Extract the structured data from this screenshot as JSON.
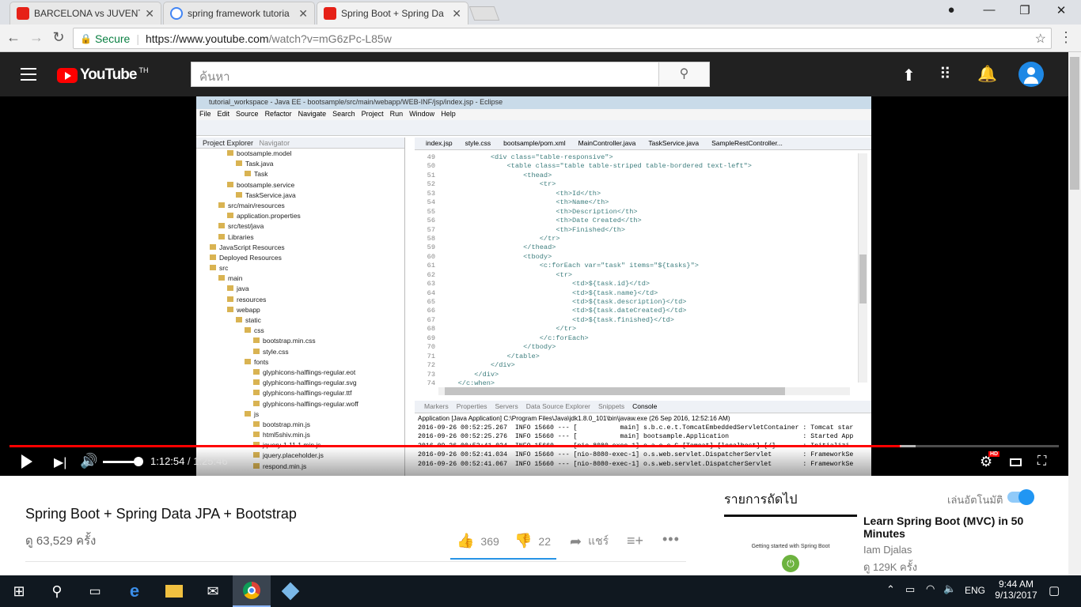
{
  "browser": {
    "tabs": [
      {
        "title": "BARCELONA vs JUVENTUS",
        "favicon": "youtube-icon"
      },
      {
        "title": "spring framework tutoria",
        "favicon": "google-icon"
      },
      {
        "title": "Spring Boot + Spring Da",
        "favicon": "youtube-icon",
        "active": true
      }
    ],
    "secure_label": "Secure",
    "url_prefix": "https://www.youtube.com",
    "url_path": "/watch?v=mG6zPc-L85w"
  },
  "youtube": {
    "logo_text": "YouTube",
    "region": "TH",
    "search_placeholder": "ค้นหา"
  },
  "eclipse": {
    "title": "tutorial_workspace - Java EE - bootsample/src/main/webapp/WEB-INF/jsp/index.jsp - Eclipse",
    "menu": [
      "File",
      "Edit",
      "Source",
      "Refactor",
      "Navigate",
      "Search",
      "Project",
      "Run",
      "Window",
      "Help"
    ],
    "project_tabs": [
      "Project Explorer",
      "Navigator"
    ],
    "tree": [
      {
        "indent": 3,
        "text": "bootsample.model"
      },
      {
        "indent": 4,
        "text": "Task.java"
      },
      {
        "indent": 5,
        "text": "Task"
      },
      {
        "indent": 3,
        "text": "bootsample.service"
      },
      {
        "indent": 4,
        "text": "TaskService.java"
      },
      {
        "indent": 2,
        "text": "src/main/resources"
      },
      {
        "indent": 3,
        "text": "application.properties"
      },
      {
        "indent": 2,
        "text": "src/test/java"
      },
      {
        "indent": 2,
        "text": "Libraries"
      },
      {
        "indent": 1,
        "text": "JavaScript Resources"
      },
      {
        "indent": 1,
        "text": "Deployed Resources"
      },
      {
        "indent": 1,
        "text": "src"
      },
      {
        "indent": 2,
        "text": "main"
      },
      {
        "indent": 3,
        "text": "java"
      },
      {
        "indent": 3,
        "text": "resources"
      },
      {
        "indent": 3,
        "text": "webapp"
      },
      {
        "indent": 4,
        "text": "static"
      },
      {
        "indent": 5,
        "text": "css"
      },
      {
        "indent": 6,
        "text": "bootstrap.min.css"
      },
      {
        "indent": 6,
        "text": "style.css"
      },
      {
        "indent": 5,
        "text": "fonts"
      },
      {
        "indent": 6,
        "text": "glyphicons-halflings-regular.eot"
      },
      {
        "indent": 6,
        "text": "glyphicons-halflings-regular.svg"
      },
      {
        "indent": 6,
        "text": "glyphicons-halflings-regular.ttf"
      },
      {
        "indent": 6,
        "text": "glyphicons-halflings-regular.woff"
      },
      {
        "indent": 5,
        "text": "js"
      },
      {
        "indent": 6,
        "text": "bootstrap.min.js"
      },
      {
        "indent": 6,
        "text": "html5shiv.min.js"
      },
      {
        "indent": 6,
        "text": "jquery-1.11.1.min.js"
      },
      {
        "indent": 6,
        "text": "jquery.placeholder.js"
      },
      {
        "indent": 6,
        "text": "respond.min.js"
      }
    ],
    "editor_tabs": [
      "index.jsp",
      "style.css",
      "bootsample/pom.xml",
      "MainController.java",
      "TaskService.java",
      "SampleRestController..."
    ],
    "code": [
      {
        "n": "49",
        "t": "            <div class=\"table-responsive\">"
      },
      {
        "n": "50",
        "t": "                <table class=\"table table-striped table-bordered text-left\">"
      },
      {
        "n": "51",
        "t": "                    <thead>"
      },
      {
        "n": "52",
        "t": "                        <tr>"
      },
      {
        "n": "53",
        "t": "                            <th>Id</th>"
      },
      {
        "n": "54",
        "t": "                            <th>Name</th>"
      },
      {
        "n": "55",
        "t": "                            <th>Description</th>"
      },
      {
        "n": "56",
        "t": "                            <th>Date Created</th>"
      },
      {
        "n": "57",
        "t": "                            <th>Finished</th>"
      },
      {
        "n": "58",
        "t": "                        </tr>"
      },
      {
        "n": "59",
        "t": "                    </thead>"
      },
      {
        "n": "60",
        "t": "                    <tbody>"
      },
      {
        "n": "61",
        "t": "                        <c:forEach var=\"task\" items=\"${tasks}\">"
      },
      {
        "n": "62",
        "t": "                            <tr>"
      },
      {
        "n": "63",
        "t": "                                <td>${task.id}</td>"
      },
      {
        "n": "64",
        "t": "                                <td>${task.name}</td>"
      },
      {
        "n": "65",
        "t": "                                <td>${task.description}</td>"
      },
      {
        "n": "66",
        "t": "                                <td>${task.dateCreated}</td>"
      },
      {
        "n": "67",
        "t": "                                <td>${task.finished}</td>"
      },
      {
        "n": "68",
        "t": "                            </tr>"
      },
      {
        "n": "69",
        "t": "                        </c:forEach>"
      },
      {
        "n": "70",
        "t": "                    </tbody>"
      },
      {
        "n": "71",
        "t": "                </table>"
      },
      {
        "n": "72",
        "t": "            </div>"
      },
      {
        "n": "73",
        "t": "        </div>"
      },
      {
        "n": "74",
        "t": "    </c:when>"
      }
    ],
    "console_tabs": [
      "Markers",
      "Properties",
      "Servers",
      "Data Source Explorer",
      "Snippets",
      "Console"
    ],
    "console_header": "Application [Java Application] C:\\Program Files\\Java\\jdk1.8.0_101\\bin\\javaw.exe (26 Sep 2016, 12:52:16 AM)",
    "console_lines": [
      "2016-09-26 00:52:25.267  INFO 15660 --- [           main] s.b.c.e.t.TomcatEmbeddedServletContainer : Tomcat star",
      "2016-09-26 00:52:25.276  INFO 15660 --- [           main] bootsample.Application                   : Started App",
      "2016-09-26 00:52:41.034  INFO 15660 --- [nio-8080-exec-1] o.a.c.c.C.[Tomcat].[localhost].[/]       : Initializi",
      "2016-09-26 00:52:41.034  INFO 15660 --- [nio-8080-exec-1] o.s.web.servlet.DispatcherServlet        : FrameworkSe",
      "2016-09-26 00:52:41.067  INFO 15660 --- [nio-8080-exec-1] o.s.web.servlet.DispatcherServlet        : FrameworkSe"
    ]
  },
  "player": {
    "current_time": "1:12:54",
    "separator": " / ",
    "duration": "1:25:46",
    "progress_fraction": 0.85,
    "hd_badge": "HD"
  },
  "video": {
    "title": "Spring Boot + Spring Data JPA + Bootstrap",
    "views": "ดู 63,529 ครั้ง",
    "likes": "369",
    "dislikes": "22",
    "share_label": "แชร์"
  },
  "upnext": {
    "heading": "รายการถัดไป",
    "autoplay_label": "เล่นอัตโนมัติ",
    "title": "Learn Spring Boot (MVC) in 50 Minutes",
    "channel": "Iam Djalas",
    "views": "ดู 129K ครั้ง",
    "thumb_text": "Getting started with Spring Boot"
  },
  "taskbar": {
    "lang": "ENG",
    "time": "9:44 AM",
    "date": "9/13/2017"
  },
  "colors": {
    "accent": "#ff0000",
    "yt_header": "#212121",
    "autoplay": "#2196f3"
  }
}
